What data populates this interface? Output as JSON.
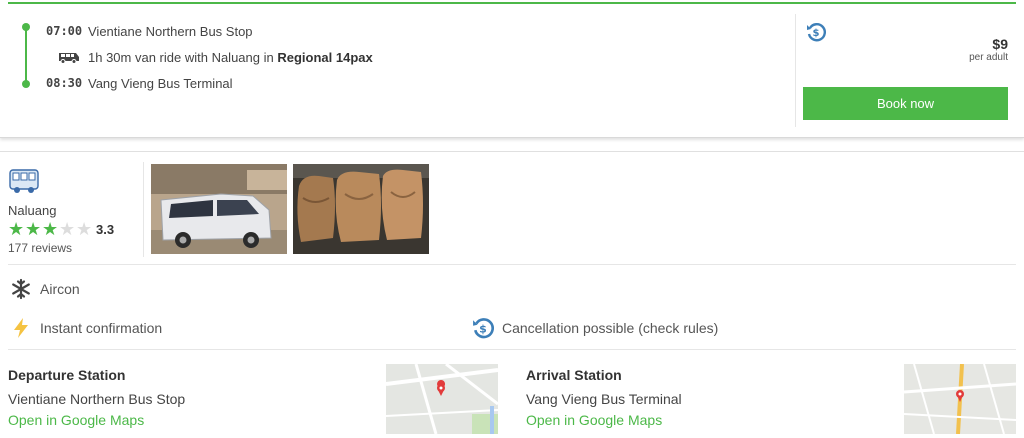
{
  "trip": {
    "departure_time": "07:00",
    "departure_stop": "Vientiane Northern Bus Stop",
    "ride_prefix": "1h 30m van ride with Naluang in",
    "vehicle": "Regional 14pax",
    "arrival_time": "08:30",
    "arrival_stop": "Vang Vieng Bus Terminal",
    "price": "$9",
    "price_unit": "per adult",
    "book_label": "Book now"
  },
  "operator": {
    "name": "Naluang",
    "rating": "3.3",
    "stars_filled": 3,
    "stars_total": 5,
    "reviews": "177 reviews"
  },
  "features": {
    "aircon": "Aircon",
    "instant": "Instant confirmation",
    "cancellation": "Cancellation possible (check rules)"
  },
  "departure_station": {
    "title": "Departure Station",
    "name": "Vientiane Northern Bus Stop",
    "link": "Open in Google Maps"
  },
  "arrival_station": {
    "title": "Arrival Station",
    "name": "Vang Vieng Bus Terminal",
    "link": "Open in Google Maps"
  },
  "colors": {
    "accent": "#4cb848",
    "refund_icon": "#3d7fb8",
    "instant_icon": "#f5c342"
  },
  "icons": [
    "timeline-dot",
    "van-icon",
    "refund-icon",
    "bus-operator-icon",
    "star-icon",
    "snowflake-icon",
    "lightning-icon",
    "map-pin-icon"
  ]
}
